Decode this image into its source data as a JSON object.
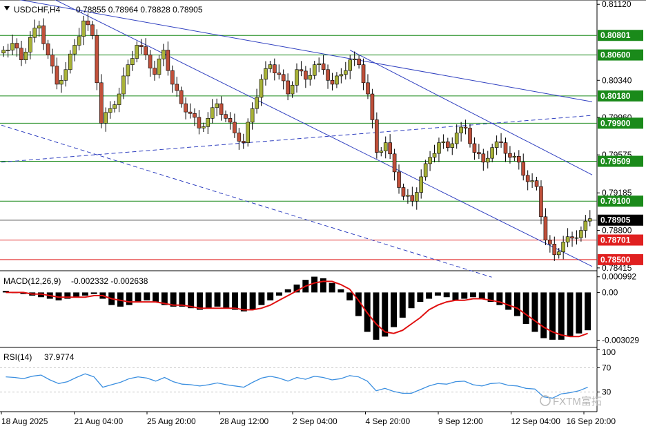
{
  "header": {
    "symbol": "USDCHF,H4",
    "quote": "0.78855 0.78964 0.78828 0.78905"
  },
  "watermark": {
    "text": "FXTM富拓"
  },
  "colors": {
    "bull_candle": "#a8b238",
    "bear_candle": "#c0503a",
    "support_line": "#1a8a1a",
    "resist_line": "#e02020",
    "trend_line": "#3040c0",
    "macd_signal": "#e01010",
    "rsi_line": "#3b8fe0"
  },
  "chart_data": [
    {
      "type": "candlestick",
      "symbol": "USDCHF,H4",
      "ylim": [
        0.784,
        0.8115
      ],
      "y_ticks": [
        "0.81120",
        "0.80340",
        "0.79960",
        "0.79575",
        "0.79185",
        "0.78800",
        "0.78415"
      ],
      "levels": [
        {
          "value": "0.80801",
          "kind": "support"
        },
        {
          "value": "0.80600",
          "kind": "support"
        },
        {
          "value": "0.80180",
          "kind": "support"
        },
        {
          "value": "0.79900",
          "kind": "support"
        },
        {
          "value": "0.79509",
          "kind": "support"
        },
        {
          "value": "0.79100",
          "kind": "support"
        },
        {
          "value": "0.78905",
          "kind": "current"
        },
        {
          "value": "0.78701",
          "kind": "resist"
        },
        {
          "value": "0.78500",
          "kind": "resist"
        }
      ],
      "x_ticks": [
        "18 Aug 2025",
        "21 Aug 04:00",
        "25 Aug 20:00",
        "28 Aug 12:00",
        "2 Sep 04:00",
        "4 Sep 20:00",
        "9 Sep 12:00",
        "12 Sep 04:00",
        "16 Sep 20:00"
      ],
      "close_path": [
        0.8065,
        0.8072,
        0.8055,
        0.8078,
        0.809,
        0.806,
        0.803,
        0.8045,
        0.807,
        0.8095,
        0.808,
        0.799,
        0.8005,
        0.802,
        0.805,
        0.807,
        0.806,
        0.804,
        0.8065,
        0.803,
        0.801,
        0.8,
        0.7985,
        0.7995,
        0.801,
        0.7995,
        0.798,
        0.797,
        0.8005,
        0.8035,
        0.805,
        0.804,
        0.802,
        0.8045,
        0.8035,
        0.805,
        0.8045,
        0.803,
        0.804,
        0.8055,
        0.805,
        0.802,
        0.796,
        0.797,
        0.794,
        0.7915,
        0.791,
        0.7935,
        0.7955,
        0.797,
        0.7965,
        0.798,
        0.7985,
        0.796,
        0.795,
        0.7965,
        0.797,
        0.7955,
        0.795,
        0.793,
        0.7925,
        0.787,
        0.7855,
        0.7868,
        0.7872,
        0.788,
        0.7892
      ],
      "trend_lines": [
        {
          "from": [
            0,
            0.812
          ],
          "to": [
            1,
            0.8012
          ]
        },
        {
          "from": [
            0,
            0.8144
          ],
          "to": [
            1,
            0.7843
          ]
        },
        {
          "from": [
            0.59,
            0.8065
          ],
          "to": [
            1,
            0.7937
          ]
        },
        {
          "from": [
            0,
            0.795
          ],
          "to": [
            1,
            0.7998
          ],
          "dashed": true
        },
        {
          "from": [
            0,
            0.7988
          ],
          "to": [
            0.83,
            0.7832
          ],
          "dashed": true
        }
      ]
    },
    {
      "type": "bar",
      "name": "MACD(12,26,9)",
      "values_label": "-0.002332 -0.002638",
      "y_ticks": [
        "0.000992",
        "0.00",
        "-0.003029"
      ],
      "ylim": [
        -0.0034,
        0.0012
      ],
      "histogram": [
        0.0001,
        0.0,
        -0.0001,
        -0.0002,
        -0.0003,
        -0.0004,
        -0.0005,
        -0.0004,
        -0.0003,
        -0.0002,
        -0.0001,
        -0.0004,
        -0.0008,
        -0.0009,
        -0.0008,
        -0.0006,
        -0.0005,
        -0.0006,
        -0.0008,
        -0.0009,
        -0.0009,
        -0.001,
        -0.0011,
        -0.001,
        -0.0009,
        -0.001,
        -0.0011,
        -0.0012,
        -0.0011,
        -0.0008,
        -0.0005,
        -0.0002,
        0.0002,
        0.0005,
        0.0008,
        0.001,
        0.0009,
        0.0006,
        0.0002,
        -0.0005,
        -0.0015,
        -0.0025,
        -0.003,
        -0.0028,
        -0.0022,
        -0.0016,
        -0.001,
        -0.0006,
        -0.0004,
        -0.0002,
        -0.0003,
        -0.0005,
        -0.0004,
        -0.0003,
        -0.0004,
        -0.0006,
        -0.0008,
        -0.0011,
        -0.0015,
        -0.002,
        -0.0025,
        -0.0029,
        -0.003,
        -0.003,
        -0.0028,
        -0.0026,
        -0.0024
      ],
      "signal": [
        0.0,
        0.0,
        0.0,
        -0.0001,
        -0.0001,
        -0.0002,
        -0.0003,
        -0.0003,
        -0.0003,
        -0.0003,
        -0.0002,
        -0.0002,
        -0.0004,
        -0.0005,
        -0.0006,
        -0.0006,
        -0.0006,
        -0.0006,
        -0.0007,
        -0.0008,
        -0.0008,
        -0.0009,
        -0.001,
        -0.001,
        -0.001,
        -0.001,
        -0.001,
        -0.0011,
        -0.0011,
        -0.001,
        -0.0008,
        -0.0005,
        -0.0002,
        0.0001,
        0.0004,
        0.0006,
        0.0007,
        0.0007,
        0.0005,
        0.0002,
        -0.0005,
        -0.0013,
        -0.002,
        -0.0025,
        -0.0026,
        -0.0024,
        -0.002,
        -0.0016,
        -0.0011,
        -0.0008,
        -0.0006,
        -0.0005,
        -0.0005,
        -0.0004,
        -0.0004,
        -0.0005,
        -0.0006,
        -0.0008,
        -0.001,
        -0.0014,
        -0.0018,
        -0.0022,
        -0.0025,
        -0.0027,
        -0.0028,
        -0.0028,
        -0.0026
      ]
    },
    {
      "type": "line",
      "name": "RSI(14)",
      "value_label": "37.9774",
      "y_ticks": [
        "100",
        "70",
        "30",
        "0"
      ],
      "ylim": [
        0,
        100
      ],
      "values": [
        55,
        54,
        52,
        56,
        58,
        50,
        44,
        47,
        54,
        60,
        55,
        38,
        42,
        46,
        52,
        55,
        53,
        48,
        54,
        47,
        43,
        42,
        40,
        42,
        45,
        42,
        40,
        38,
        46,
        53,
        56,
        53,
        48,
        54,
        51,
        56,
        54,
        50,
        52,
        57,
        55,
        48,
        32,
        36,
        31,
        28,
        28,
        34,
        40,
        44,
        43,
        47,
        48,
        42,
        40,
        44,
        45,
        41,
        40,
        36,
        35,
        22,
        20,
        27,
        29,
        32,
        38
      ]
    }
  ]
}
